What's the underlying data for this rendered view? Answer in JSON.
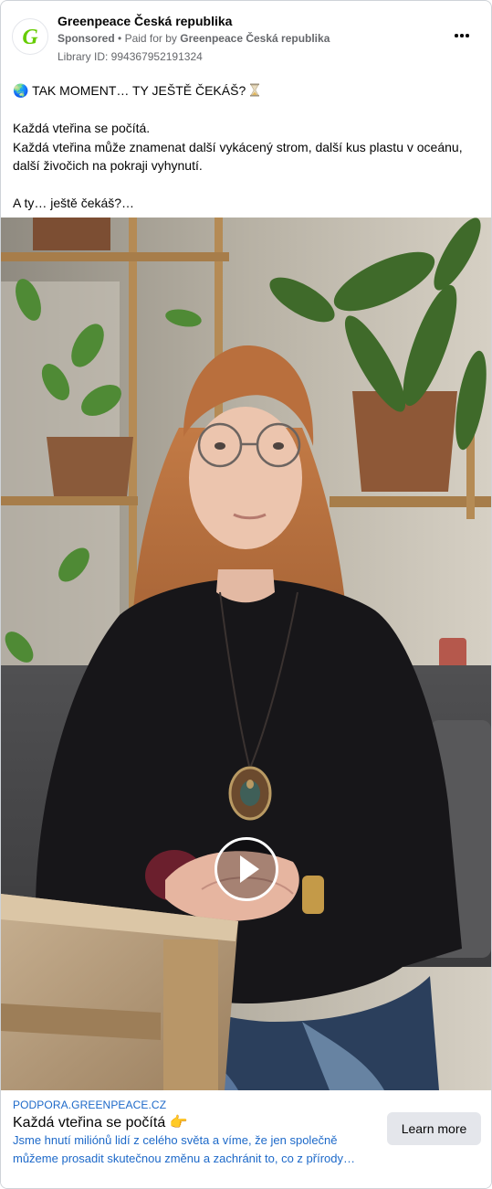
{
  "header": {
    "page_name": "Greenpeace Česká republika",
    "sponsored_label": "Sponsored",
    "separator": "•",
    "paid_for_prefix": "Paid for by",
    "paid_for_name": "Greenpeace Česká republika",
    "library_id": "Library ID: 994367952191324",
    "avatar_letter": "G",
    "avatar_icon": "greenpeace-logo-icon",
    "more_icon": "more-options-icon"
  },
  "post": {
    "line1_emoji": "🌏",
    "line1_text": "TAK MOMENT… TY JEŠTĚ ČEKÁŠ?",
    "line1_icon": "hourglass-icon",
    "line2": "Každá vteřina se počítá.",
    "line3": "Každá vteřina může znamenat další vykácený strom, další kus plastu v oceánu,",
    "line4": "další živočich na pokraji vyhynutí.",
    "line5": "A ty… ještě čekáš?…"
  },
  "media": {
    "play_icon": "play-icon"
  },
  "footer": {
    "domain": "PODPORA.GREENPEACE.CZ",
    "headline": "Každá vteřina se počítá",
    "headline_emoji": "👉",
    "description_line1": "Jsme hnutí miliónů lidí z celého světa a víme, že jen společně",
    "description_line2": "můžeme prosadit skutečnou změnu a zachránit to, co z přírody…",
    "cta_label": "Learn more"
  },
  "colors": {
    "brand_green": "#66cc00",
    "link_blue": "#1d69c9",
    "cta_bg": "#e4e6eb"
  }
}
